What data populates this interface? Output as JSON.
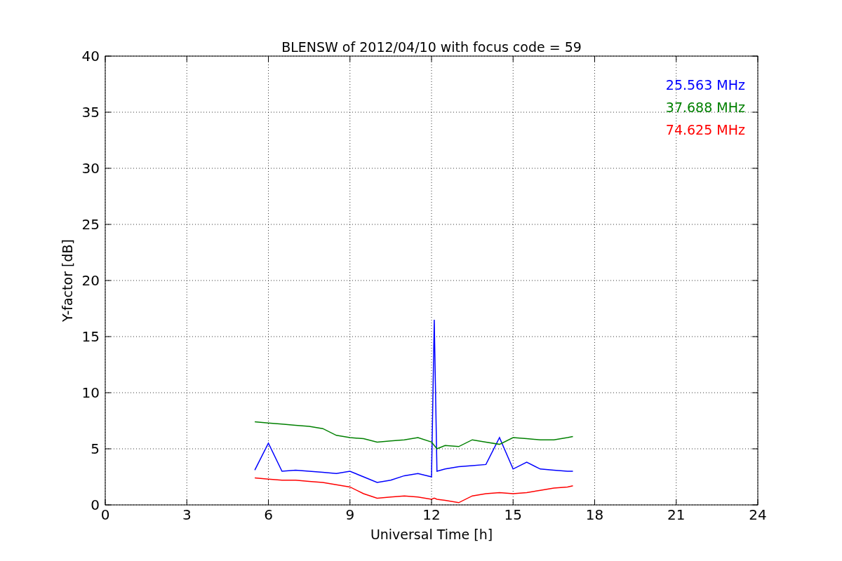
{
  "chart_data": {
    "type": "line",
    "title": "BLENSW of 2012/04/10 with focus code = 59",
    "xlabel": "Universal Time [h]",
    "ylabel": "Y-factor [dB]",
    "x": [
      5.5,
      6,
      6.5,
      7,
      7.5,
      8,
      8.5,
      9,
      9.5,
      10,
      10.5,
      11,
      11.5,
      12,
      12.1,
      12.2,
      12.5,
      13,
      13.5,
      14,
      14.5,
      15,
      15.5,
      16,
      16.5,
      17,
      17.2
    ],
    "series": [
      {
        "name": "25.563 MHz",
        "color": "#0000ff",
        "values": [
          3.1,
          5.5,
          3.0,
          3.1,
          3.0,
          2.9,
          2.8,
          3.0,
          2.5,
          2.0,
          2.2,
          2.6,
          2.8,
          2.5,
          16.5,
          3.0,
          3.2,
          3.4,
          3.5,
          3.6,
          6.0,
          3.2,
          3.8,
          3.2,
          3.1,
          3.0,
          3.0
        ]
      },
      {
        "name": "37.688 MHz",
        "color": "#008000",
        "values": [
          7.4,
          7.3,
          7.2,
          7.1,
          7.0,
          6.8,
          6.2,
          6.0,
          5.9,
          5.6,
          5.7,
          5.8,
          6.0,
          5.6,
          5.3,
          5.0,
          5.3,
          5.2,
          5.8,
          5.6,
          5.4,
          6.0,
          5.9,
          5.8,
          5.8,
          6.0,
          6.1
        ]
      },
      {
        "name": "74.625 MHz",
        "color": "#ff0000",
        "values": [
          2.4,
          2.3,
          2.2,
          2.2,
          2.1,
          2.0,
          1.8,
          1.6,
          1.0,
          0.6,
          0.7,
          0.8,
          0.7,
          0.5,
          0.6,
          0.5,
          0.4,
          0.2,
          0.8,
          1.0,
          1.1,
          1.0,
          1.1,
          1.3,
          1.5,
          1.6,
          1.7
        ]
      }
    ],
    "grid": true,
    "xlim": [
      0,
      24
    ],
    "ylim": [
      0,
      40
    ],
    "xticks": [
      0,
      3,
      6,
      9,
      12,
      15,
      18,
      21,
      24
    ],
    "yticks": [
      0,
      5,
      10,
      15,
      20,
      25,
      30,
      35,
      40
    ]
  }
}
